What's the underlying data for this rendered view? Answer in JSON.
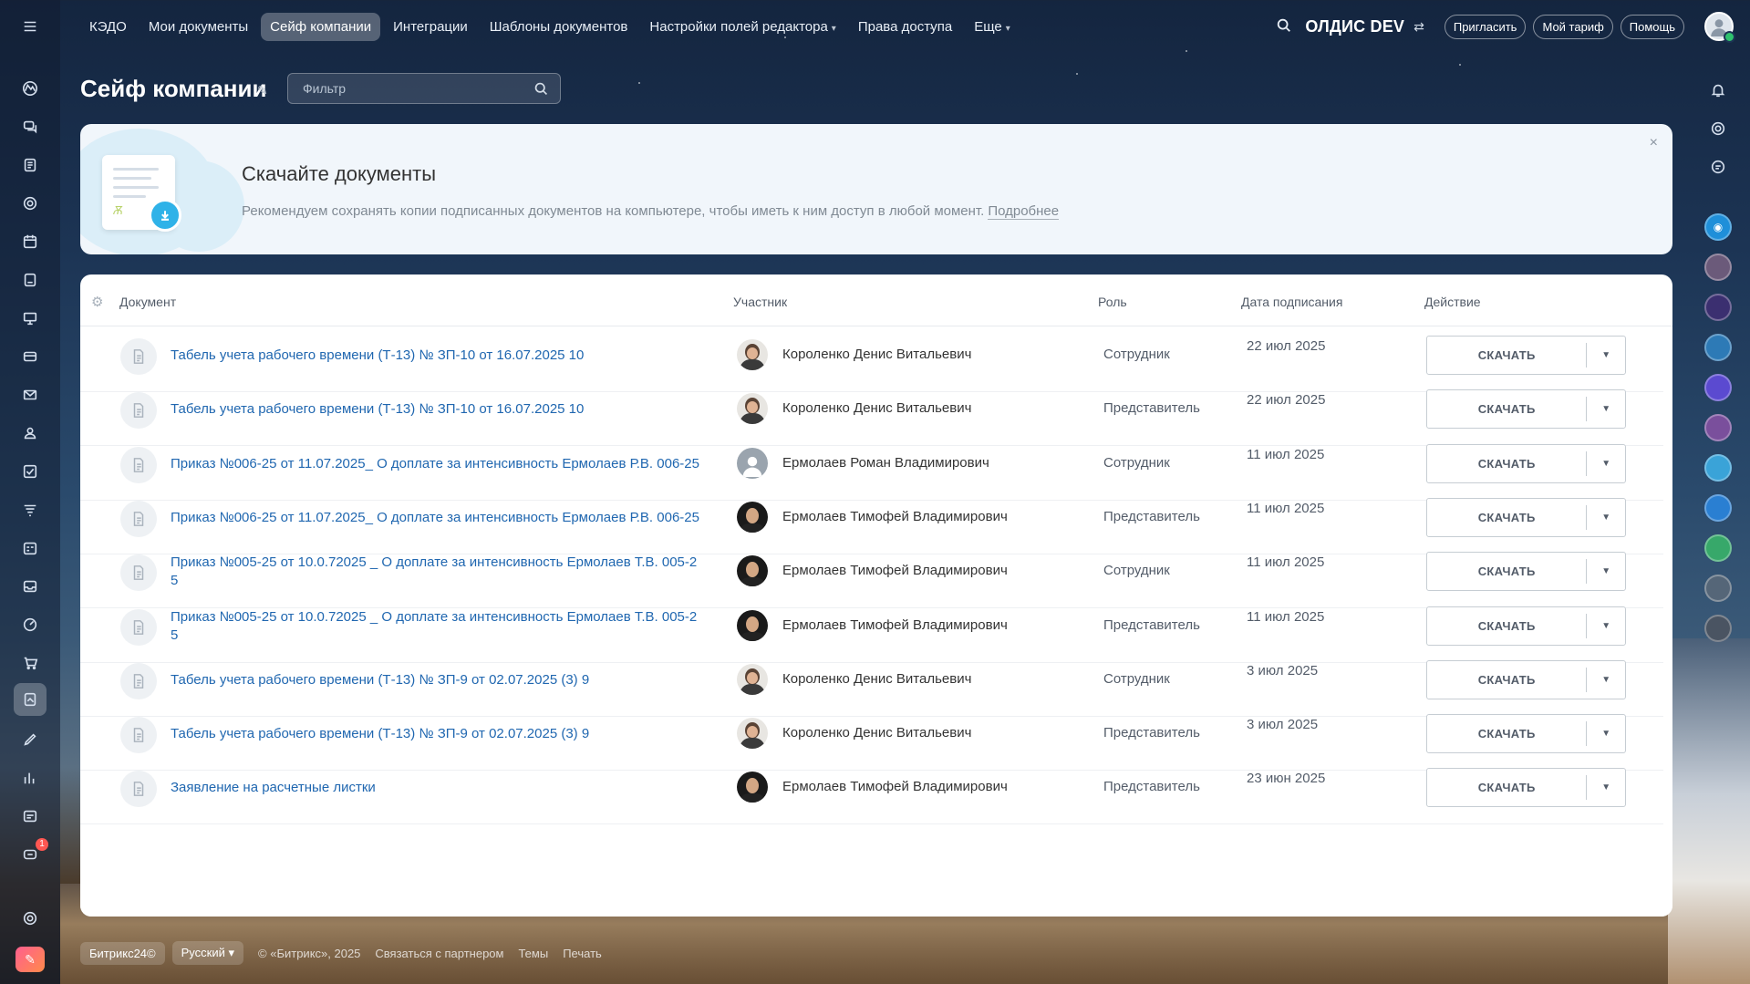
{
  "topnav": {
    "items": [
      {
        "label": "КЭДО"
      },
      {
        "label": "Мои документы"
      },
      {
        "label": "Сейф компании"
      },
      {
        "label": "Интеграции"
      },
      {
        "label": "Шаблоны документов"
      },
      {
        "label": "Настройки полей редактора"
      },
      {
        "label": "Права доступа"
      },
      {
        "label": "Еще"
      }
    ],
    "company": "ОЛДИС DEV",
    "invite": "Пригласить",
    "tariff": "Мой тариф",
    "help": "Помощь"
  },
  "page": {
    "title": "Сейф компании",
    "filter_placeholder": "Фильтр"
  },
  "banner": {
    "title": "Скачайте документы",
    "text": "Рекомендуем сохранять копии подписанных документов на компьютере, чтобы иметь к ним доступ в любой момент.",
    "link": "Подробнее",
    "close": "×"
  },
  "table": {
    "columns": {
      "document": "Документ",
      "participant": "Участник",
      "role": "Роль",
      "date": "Дата подписания",
      "action": "Действие"
    },
    "rows": [
      {
        "doc": "Табель учета рабочего времени (Т-13) № ЗП-10 от 16.07.2025 10",
        "person": "Короленко Денис Витальевич",
        "role": "Сотрудник",
        "date": "22 июл 2025",
        "action": "СКАЧАТЬ"
      },
      {
        "doc": "Табель учета рабочего времени (Т-13) № ЗП-10 от 16.07.2025 10",
        "person": "Короленко Денис Витальевич",
        "role": "Представитель",
        "date": "22 июл 2025",
        "action": "СКАЧАТЬ"
      },
      {
        "doc": "Приказ №006-25 от 11.07.2025_ О доплате за интенсивность Ермолаев Р.В. 006-25",
        "person": "Ермолаев Роман Владимирович",
        "role": "Сотрудник",
        "date": "11 июл 2025",
        "action": "СКАЧАТЬ"
      },
      {
        "doc": "Приказ №006-25 от 11.07.2025_ О доплате за интенсивность Ермолаев Р.В. 006-25",
        "person": "Ермолаев Тимофей Владимирович",
        "role": "Представитель",
        "date": "11 июл 2025",
        "action": "СКАЧАТЬ"
      },
      {
        "doc": "Приказ №005-25 от 10.0.72025 _ О доплате за интенсивность Ермолаев Т.В. 005-2 5",
        "person": "Ермолаев Тимофей Владимирович",
        "role": "Сотрудник",
        "date": "11 июл 2025",
        "action": "СКАЧАТЬ"
      },
      {
        "doc": "Приказ №005-25 от 10.0.72025 _ О доплате за интенсивность Ермолаев Т.В. 005-2 5",
        "person": "Ермолаев Тимофей Владимирович",
        "role": "Представитель",
        "date": "11 июл 2025",
        "action": "СКАЧАТЬ"
      },
      {
        "doc": "Табель учета рабочего времени (Т-13) № ЗП-9 от 02.07.2025 (3) 9",
        "person": "Короленко Денис Витальевич",
        "role": "Сотрудник",
        "date": "3 июл 2025",
        "action": "СКАЧАТЬ"
      },
      {
        "doc": "Табель учета рабочего времени (Т-13) № ЗП-9 от 02.07.2025 (3) 9",
        "person": "Короленко Денис Витальевич",
        "role": "Представитель",
        "date": "3 июл 2025",
        "action": "СКАЧАТЬ"
      },
      {
        "doc": "Заявление на расчетные листки",
        "person": "Ермолаев Тимофей Владимирович",
        "role": "Представитель",
        "date": "23 июн 2025",
        "action": "СКАЧАТЬ"
      }
    ]
  },
  "sidebar": {
    "badge": "1"
  },
  "footer": {
    "brand": "Битрикс24©",
    "language": "Русский",
    "copyright": "© «Битрикс», 2025",
    "partner": "Связаться с партнером",
    "themes": "Темы",
    "print": "Печать"
  }
}
